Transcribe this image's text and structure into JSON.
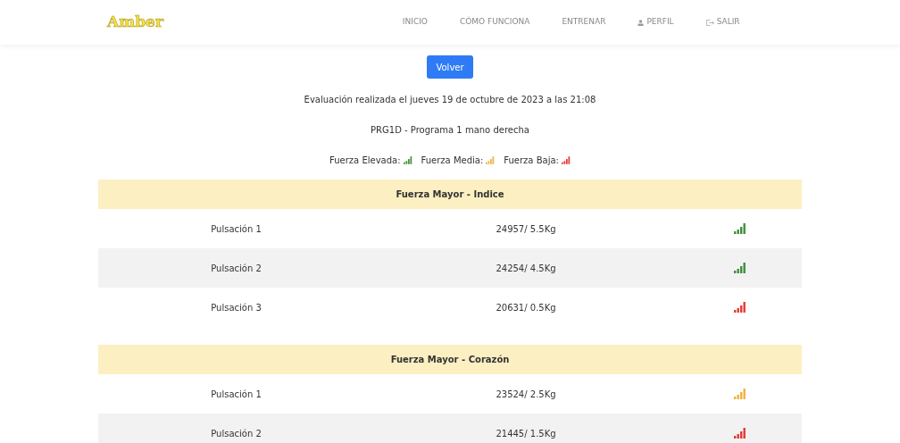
{
  "header": {
    "logo": "Amber",
    "nav": [
      {
        "label": "INICIO",
        "kind": "plain"
      },
      {
        "label": "CÓMO FUNCIONA",
        "kind": "plain"
      },
      {
        "label": "ENTRENAR",
        "kind": "plain"
      },
      {
        "label": "PERFIL",
        "kind": "profile"
      },
      {
        "label": "SALIR",
        "kind": "logout"
      }
    ]
  },
  "back_button": "Volver",
  "evaluation_date": "Evaluación realizada el jueves 19 de octubre de 2023 a las 21:08",
  "program": "PRG1D - Programa 1 mano derecha",
  "legend": [
    {
      "label": "Fuerza Elevada:",
      "color": "#3f8f3a"
    },
    {
      "label": "Fuerza Media:",
      "color": "#f0b13c"
    },
    {
      "label": "Fuerza Baja:",
      "color": "#e53935"
    }
  ],
  "sections": [
    {
      "title": "Fuerza Mayor - Indice",
      "rows": [
        {
          "label": "Pulsación 1",
          "value": "24957/ 5.5Kg",
          "color": "#3f8f3a"
        },
        {
          "label": "Pulsación 2",
          "value": "24254/ 4.5Kg",
          "color": "#3f8f3a"
        },
        {
          "label": "Pulsación 3",
          "value": "20631/ 0.5Kg",
          "color": "#e53935"
        }
      ]
    },
    {
      "title": "Fuerza Mayor - Corazón",
      "rows": [
        {
          "label": "Pulsación 1",
          "value": "23524/ 2.5Kg",
          "color": "#f0b13c"
        },
        {
          "label": "Pulsación 2",
          "value": "21445/ 1.5Kg",
          "color": "#e53935"
        }
      ]
    }
  ]
}
